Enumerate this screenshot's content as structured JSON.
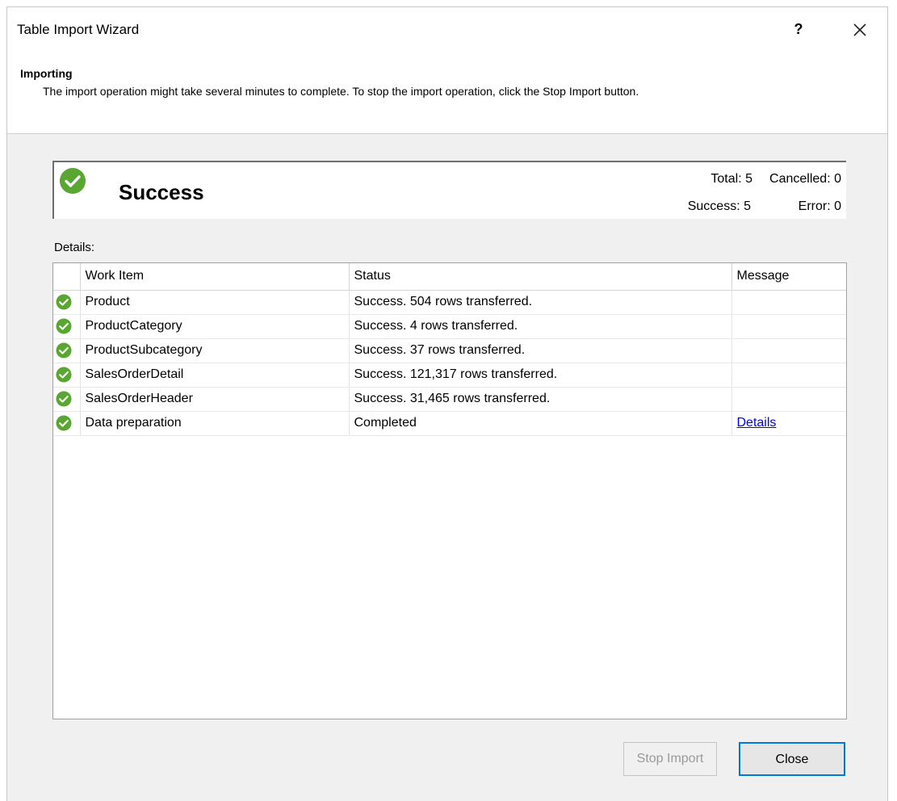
{
  "window": {
    "title": "Table Import Wizard",
    "help_label": "?"
  },
  "header": {
    "title": "Importing",
    "description": "The import operation might take several minutes to complete. To stop the import operation, click the Stop Import button."
  },
  "summary": {
    "status": "Success",
    "total_label": "Total: 5",
    "cancelled_label": "Cancelled: 0",
    "success_label": "Success: 5",
    "error_label": "Error: 0"
  },
  "details": {
    "label": "Details:",
    "columns": [
      "Work Item",
      "Status",
      "Message"
    ],
    "rows": [
      {
        "item": "Product",
        "status": "Success. 504 rows transferred.",
        "message": ""
      },
      {
        "item": "ProductCategory",
        "status": "Success. 4 rows transferred.",
        "message": ""
      },
      {
        "item": "ProductSubcategory",
        "status": "Success. 37 rows transferred.",
        "message": ""
      },
      {
        "item": "SalesOrderDetail",
        "status": "Success. 121,317 rows transferred.",
        "message": ""
      },
      {
        "item": "SalesOrderHeader",
        "status": "Success. 31,465 rows transferred.",
        "message": ""
      },
      {
        "item": "Data preparation",
        "status": "Completed",
        "message": "Details"
      }
    ]
  },
  "buttons": {
    "stop_import": "Stop Import",
    "close": "Close"
  },
  "icons": {
    "success": "check-circle-icon",
    "close": "close-icon"
  },
  "colors": {
    "success_green": "#5aa632",
    "accent_blue": "#0078d7",
    "link_blue": "#0000ee"
  }
}
